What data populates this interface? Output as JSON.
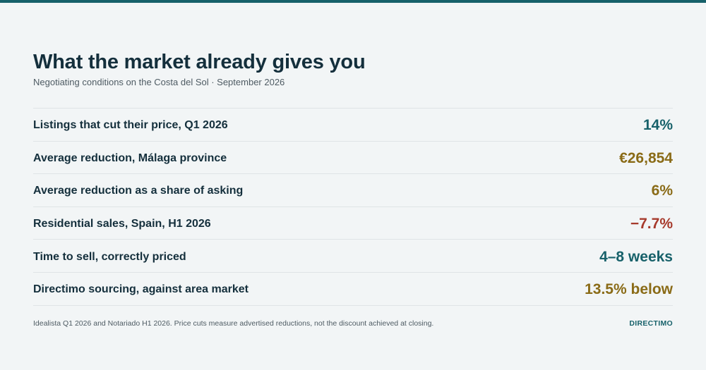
{
  "header": {
    "title": "What the market already gives you",
    "subtitle": "Negotiating conditions on the Costa del Sol · September 2026"
  },
  "colors": {
    "accent_teal": "#17616a",
    "accent_gold": "#8a6b17",
    "accent_red": "#a63a2c",
    "text_dark": "#142f3c"
  },
  "rows": [
    {
      "label": "Listings that cut their price, Q1 2026",
      "value": "14%",
      "color": "#17616a"
    },
    {
      "label": "Average reduction, Málaga province",
      "value": "€26,854",
      "color": "#8a6b17"
    },
    {
      "label": "Average reduction as a share of asking",
      "value": "6%",
      "color": "#8a6b17"
    },
    {
      "label": "Residential sales, Spain, H1 2026",
      "value": "−7.7%",
      "color": "#a63a2c"
    },
    {
      "label": "Time to sell, correctly priced",
      "value": "4–8 weeks",
      "color": "#17616a"
    },
    {
      "label": "Directimo sourcing, against area market",
      "value": "13.5% below",
      "color": "#8a6b17"
    }
  ],
  "footer": {
    "note": "Idealista Q1 2026 and Notariado H1 2026. Price cuts measure advertised reductions, not the discount achieved at closing.",
    "brand": "DIRECTIMO"
  }
}
